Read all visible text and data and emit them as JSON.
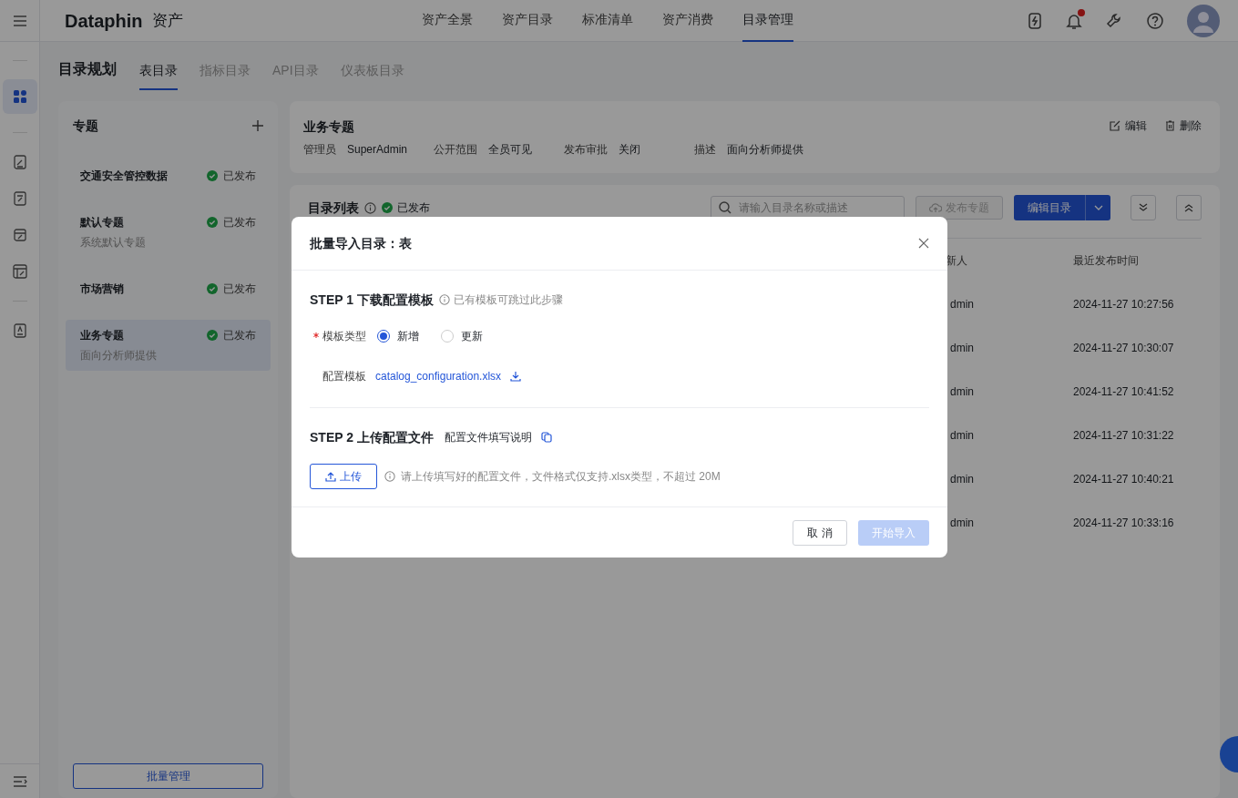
{
  "header": {
    "logo": "Dataphin",
    "product": "资产",
    "nav": [
      {
        "label": "资产全景",
        "selected": false
      },
      {
        "label": "资产目录",
        "selected": false
      },
      {
        "label": "标准清单",
        "selected": false
      },
      {
        "label": "资产消费",
        "selected": false
      },
      {
        "label": "目录管理",
        "selected": true
      }
    ],
    "has_notification": true
  },
  "page_tabs": {
    "title": "目录规划",
    "tabs": [
      {
        "label": "表目录",
        "selected": true
      },
      {
        "label": "指标目录",
        "selected": false
      },
      {
        "label": "API目录",
        "selected": false
      },
      {
        "label": "仪表板目录",
        "selected": false
      }
    ]
  },
  "topic_panel": {
    "title": "专题",
    "items": [
      {
        "name": "交通安全管控数据",
        "status": "已发布",
        "selected": false
      },
      {
        "name": "默认专题",
        "description": "系统默认专题",
        "status": "已发布",
        "selected": false
      },
      {
        "name": "市场营销",
        "status": "已发布",
        "selected": false
      },
      {
        "name": "业务专题",
        "description": "面向分析师提供",
        "status": "已发布",
        "selected": true
      }
    ],
    "batch_button": "批量管理"
  },
  "topic_detail": {
    "title": "业务专题",
    "fields": [
      {
        "label": "管理员",
        "value": "SuperAdmin"
      },
      {
        "label": "公开范围",
        "value": "全员可见"
      },
      {
        "label": "发布审批",
        "value": "关闭"
      },
      {
        "label": "描述",
        "value": "面向分析师提供"
      }
    ],
    "actions": [
      {
        "kind": "edit",
        "label": "编辑"
      },
      {
        "kind": "delete",
        "label": "删除"
      }
    ]
  },
  "catalog_list": {
    "title": "目录列表",
    "status": "已发布",
    "search": {
      "placeholder": "请输入目录名称或描述"
    },
    "publish_button": {
      "label": "发布专题",
      "disabled": true
    },
    "edit_button": "编辑目录",
    "columns": [
      "新人",
      "最近发布时间"
    ],
    "rows": [
      [
        "dmin",
        "2024-11-27 10:27:56"
      ],
      [
        "dmin",
        "2024-11-27 10:30:07"
      ],
      [
        "dmin",
        "2024-11-27 10:41:52"
      ],
      [
        "dmin",
        "2024-11-27 10:31:22"
      ],
      [
        "dmin",
        "2024-11-27 10:40:21"
      ],
      [
        "dmin",
        "2024-11-27 10:33:16"
      ]
    ]
  },
  "dialog": {
    "title": "批量导入目录：表",
    "step1": {
      "title": "STEP 1 下载配置模板",
      "hint": "已有模板可跳过此步骤"
    },
    "template_type": {
      "label": "模板类型",
      "required": true,
      "options": [
        {
          "label": "新增",
          "selected": true
        },
        {
          "label": "更新",
          "selected": false
        }
      ]
    },
    "template": {
      "label": "配置模板",
      "file": "catalog_configuration.xlsx"
    },
    "step2": {
      "title": "STEP 2 上传配置文件",
      "link": "配置文件填写说明"
    },
    "upload_button": "上传",
    "upload_hint": "请上传填写好的配置文件，文件格式仅支持.xlsx类型，不超过 20M",
    "cancel_button": "取 消",
    "start_button": {
      "label": "开始导入",
      "disabled": true
    }
  }
}
